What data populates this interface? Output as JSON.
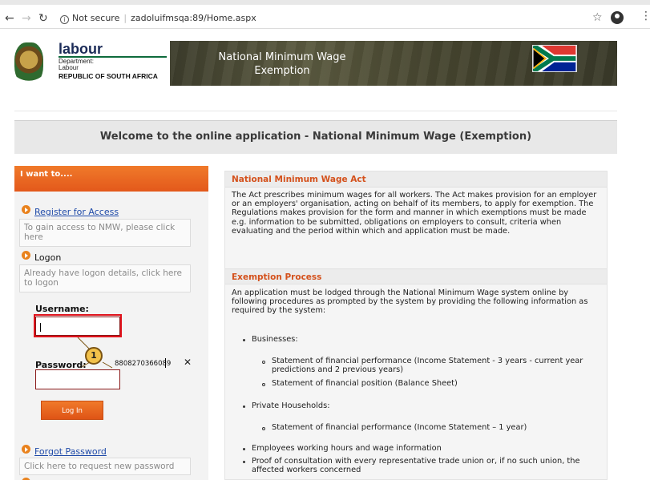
{
  "browser": {
    "not_secure": "Not secure",
    "url": "zadoluifmsqa:89/Home.aspx"
  },
  "header": {
    "logo_labour": "labour",
    "logo_department": "Department:",
    "logo_labour_small": "Labour",
    "logo_country": "REPUBLIC OF SOUTH AFRICA",
    "banner_line1": "National Minimum Wage",
    "banner_line2": "Exemption"
  },
  "welcome": "Welcome to the online application - National Minimum Wage (Exemption)",
  "left_panel": {
    "title": "I want to....",
    "register_link": "Register for Access",
    "register_hint": "To gain access to NMW, please click here",
    "logon_label": "Logon",
    "logon_hint": "Already have logon details, click here to logon",
    "username_label": "Username:",
    "username_value": "",
    "password_label": "Password:",
    "password_value": "8808270366089",
    "login_button": "Log In",
    "forgot_link": "Forgot Password",
    "forgot_hint": "Click here to request new password",
    "callout_number": "1"
  },
  "right_panel": {
    "act_heading": "National Minimum Wage Act",
    "act_text": "The Act prescribes minimum wages for all workers. The Act makes provision for an employer or an employers' organisation, acting on behalf of its members, to apply for exemption. The Regulations makes provision for the form and manner in which exemptions must be made e.g. information to be submitted, obligations on employers to consult, criteria when evaluating and the period within which and application must be made.",
    "process_heading": "Exemption Process",
    "process_text": "An application must be lodged through the National Minimum Wage system online by following procedures as prompted by the system by providing the following information as required by the system:",
    "businesses": "Businesses:",
    "business_item1": "Statement of financial performance (Income Statement - 3 years - current year predictions and 2 previous years)",
    "business_item2": "Statement of financial position (Balance Sheet)",
    "households": "Private Households:",
    "household_item1": "Statement of financial performance (Income Statement – 1 year)",
    "employees": "Employees working hours and wage information",
    "consultation": "Proof of consultation with every representative trade union or, if no such union, the affected workers concerned"
  },
  "colors": {
    "accent_orange": "#e3581b",
    "heading_orange": "#d4511c",
    "link_blue": "#1f4aa8",
    "highlight_red": "#e0121b"
  }
}
